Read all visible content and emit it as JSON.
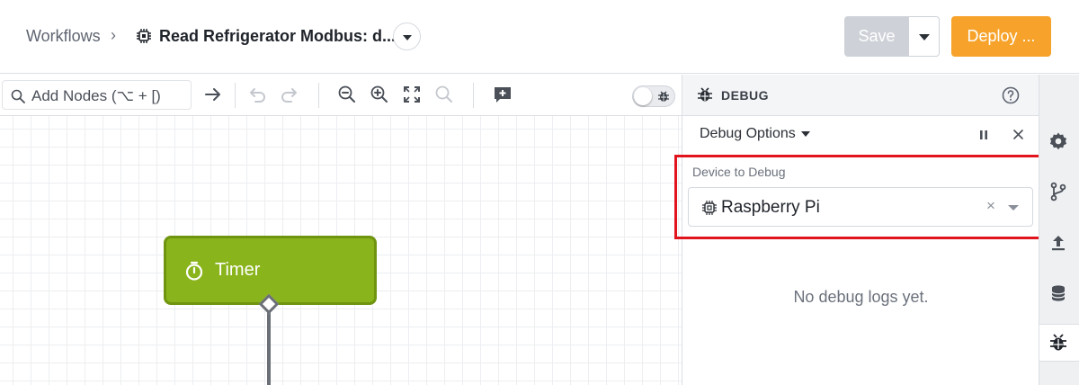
{
  "header": {
    "breadcrumb_root": "Workflows",
    "breadcrumb_sep": "›",
    "workflow_title": "Read Refrigerator Modbus: d...",
    "save_label": "Save",
    "deploy_label": "Deploy ...",
    "deploy_color": "#f7a32b",
    "save_color": "#ced2d8"
  },
  "toolbar": {
    "add_nodes_placeholder": "Add Nodes (⌥ + [)",
    "icons": [
      "search-icon",
      "arrow-right-icon",
      "undo-icon",
      "redo-icon",
      "zoom-out-icon",
      "zoom-in-icon",
      "fit-screen-icon",
      "zoom-reset-icon",
      "add-comment-icon",
      "debug-toggle"
    ]
  },
  "canvas": {
    "node": {
      "label": "Timer",
      "color": "#8ab41c",
      "icon": "stopwatch-icon"
    }
  },
  "debug_panel": {
    "title": "DEBUG",
    "options_label": "Debug Options",
    "device_label": "Device to Debug",
    "device_value": "Raspberry Pi",
    "clear_symbol": "×",
    "empty_message": "No debug logs yet."
  },
  "rail": {
    "icons": [
      "gear-icon",
      "branch-icon",
      "upload-icon",
      "database-icon",
      "bug-icon"
    ],
    "active": "bug-icon"
  }
}
